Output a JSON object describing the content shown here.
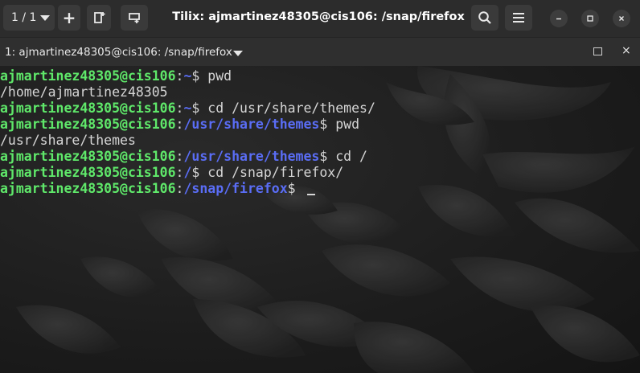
{
  "window": {
    "title": "Tilix: ajmartinez48305@cis106: /snap/firefox",
    "session_switcher": "1 / 1",
    "icons": {
      "add": "plus-icon",
      "add_right": "add-terminal-right-icon",
      "add_down": "add-terminal-down-icon",
      "search": "search-icon",
      "menu": "hamburger-menu-icon",
      "minimize": "minimize-icon",
      "maximize": "maximize-icon",
      "close": "close-icon"
    }
  },
  "terminal": {
    "title": "1: ajmartinez48305@cis106: /snap/firefox",
    "colors": {
      "user_host": "#5fe86a",
      "path": "#5a6df5",
      "text": "#d6d6d6"
    },
    "lines": [
      {
        "kind": "prompt",
        "user": "ajmartinez48305@cis106",
        "path": "~",
        "cmd": "pwd"
      },
      {
        "kind": "output",
        "text": "/home/ajmartinez48305"
      },
      {
        "kind": "prompt",
        "user": "ajmartinez48305@cis106",
        "path": "~",
        "cmd": "cd /usr/share/themes/"
      },
      {
        "kind": "prompt",
        "user": "ajmartinez48305@cis106",
        "path": "/usr/share/themes",
        "cmd": "pwd"
      },
      {
        "kind": "output",
        "text": "/usr/share/themes"
      },
      {
        "kind": "prompt",
        "user": "ajmartinez48305@cis106",
        "path": "/usr/share/themes",
        "cmd": "cd /"
      },
      {
        "kind": "prompt",
        "user": "ajmartinez48305@cis106",
        "path": "/",
        "cmd": "cd /snap/firefox/"
      },
      {
        "kind": "prompt",
        "user": "ajmartinez48305@cis106",
        "path": "/snap/firefox",
        "cmd": ""
      }
    ]
  }
}
